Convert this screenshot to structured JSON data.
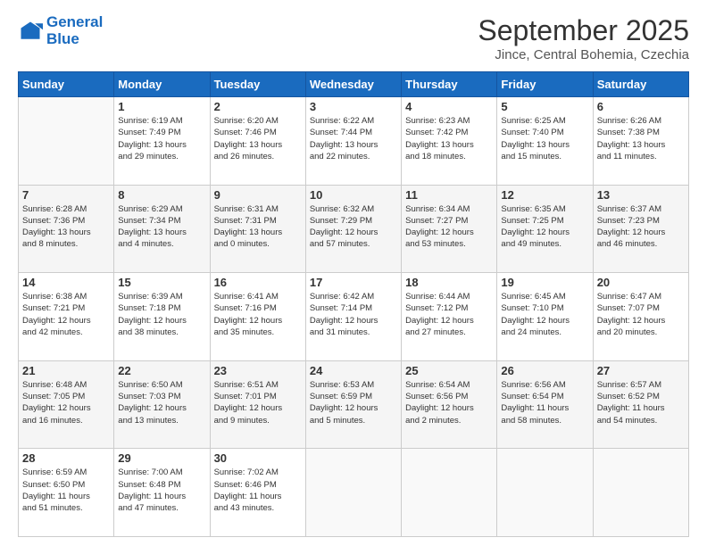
{
  "logo": {
    "line1": "General",
    "line2": "Blue"
  },
  "title": "September 2025",
  "location": "Jince, Central Bohemia, Czechia",
  "days_of_week": [
    "Sunday",
    "Monday",
    "Tuesday",
    "Wednesday",
    "Thursday",
    "Friday",
    "Saturday"
  ],
  "weeks": [
    [
      {
        "day": "",
        "info": ""
      },
      {
        "day": "1",
        "info": "Sunrise: 6:19 AM\nSunset: 7:49 PM\nDaylight: 13 hours\nand 29 minutes."
      },
      {
        "day": "2",
        "info": "Sunrise: 6:20 AM\nSunset: 7:46 PM\nDaylight: 13 hours\nand 26 minutes."
      },
      {
        "day": "3",
        "info": "Sunrise: 6:22 AM\nSunset: 7:44 PM\nDaylight: 13 hours\nand 22 minutes."
      },
      {
        "day": "4",
        "info": "Sunrise: 6:23 AM\nSunset: 7:42 PM\nDaylight: 13 hours\nand 18 minutes."
      },
      {
        "day": "5",
        "info": "Sunrise: 6:25 AM\nSunset: 7:40 PM\nDaylight: 13 hours\nand 15 minutes."
      },
      {
        "day": "6",
        "info": "Sunrise: 6:26 AM\nSunset: 7:38 PM\nDaylight: 13 hours\nand 11 minutes."
      }
    ],
    [
      {
        "day": "7",
        "info": "Sunrise: 6:28 AM\nSunset: 7:36 PM\nDaylight: 13 hours\nand 8 minutes."
      },
      {
        "day": "8",
        "info": "Sunrise: 6:29 AM\nSunset: 7:34 PM\nDaylight: 13 hours\nand 4 minutes."
      },
      {
        "day": "9",
        "info": "Sunrise: 6:31 AM\nSunset: 7:31 PM\nDaylight: 13 hours\nand 0 minutes."
      },
      {
        "day": "10",
        "info": "Sunrise: 6:32 AM\nSunset: 7:29 PM\nDaylight: 12 hours\nand 57 minutes."
      },
      {
        "day": "11",
        "info": "Sunrise: 6:34 AM\nSunset: 7:27 PM\nDaylight: 12 hours\nand 53 minutes."
      },
      {
        "day": "12",
        "info": "Sunrise: 6:35 AM\nSunset: 7:25 PM\nDaylight: 12 hours\nand 49 minutes."
      },
      {
        "day": "13",
        "info": "Sunrise: 6:37 AM\nSunset: 7:23 PM\nDaylight: 12 hours\nand 46 minutes."
      }
    ],
    [
      {
        "day": "14",
        "info": "Sunrise: 6:38 AM\nSunset: 7:21 PM\nDaylight: 12 hours\nand 42 minutes."
      },
      {
        "day": "15",
        "info": "Sunrise: 6:39 AM\nSunset: 7:18 PM\nDaylight: 12 hours\nand 38 minutes."
      },
      {
        "day": "16",
        "info": "Sunrise: 6:41 AM\nSunset: 7:16 PM\nDaylight: 12 hours\nand 35 minutes."
      },
      {
        "day": "17",
        "info": "Sunrise: 6:42 AM\nSunset: 7:14 PM\nDaylight: 12 hours\nand 31 minutes."
      },
      {
        "day": "18",
        "info": "Sunrise: 6:44 AM\nSunset: 7:12 PM\nDaylight: 12 hours\nand 27 minutes."
      },
      {
        "day": "19",
        "info": "Sunrise: 6:45 AM\nSunset: 7:10 PM\nDaylight: 12 hours\nand 24 minutes."
      },
      {
        "day": "20",
        "info": "Sunrise: 6:47 AM\nSunset: 7:07 PM\nDaylight: 12 hours\nand 20 minutes."
      }
    ],
    [
      {
        "day": "21",
        "info": "Sunrise: 6:48 AM\nSunset: 7:05 PM\nDaylight: 12 hours\nand 16 minutes."
      },
      {
        "day": "22",
        "info": "Sunrise: 6:50 AM\nSunset: 7:03 PM\nDaylight: 12 hours\nand 13 minutes."
      },
      {
        "day": "23",
        "info": "Sunrise: 6:51 AM\nSunset: 7:01 PM\nDaylight: 12 hours\nand 9 minutes."
      },
      {
        "day": "24",
        "info": "Sunrise: 6:53 AM\nSunset: 6:59 PM\nDaylight: 12 hours\nand 5 minutes."
      },
      {
        "day": "25",
        "info": "Sunrise: 6:54 AM\nSunset: 6:56 PM\nDaylight: 12 hours\nand 2 minutes."
      },
      {
        "day": "26",
        "info": "Sunrise: 6:56 AM\nSunset: 6:54 PM\nDaylight: 11 hours\nand 58 minutes."
      },
      {
        "day": "27",
        "info": "Sunrise: 6:57 AM\nSunset: 6:52 PM\nDaylight: 11 hours\nand 54 minutes."
      }
    ],
    [
      {
        "day": "28",
        "info": "Sunrise: 6:59 AM\nSunset: 6:50 PM\nDaylight: 11 hours\nand 51 minutes."
      },
      {
        "day": "29",
        "info": "Sunrise: 7:00 AM\nSunset: 6:48 PM\nDaylight: 11 hours\nand 47 minutes."
      },
      {
        "day": "30",
        "info": "Sunrise: 7:02 AM\nSunset: 6:46 PM\nDaylight: 11 hours\nand 43 minutes."
      },
      {
        "day": "",
        "info": ""
      },
      {
        "day": "",
        "info": ""
      },
      {
        "day": "",
        "info": ""
      },
      {
        "day": "",
        "info": ""
      }
    ]
  ]
}
